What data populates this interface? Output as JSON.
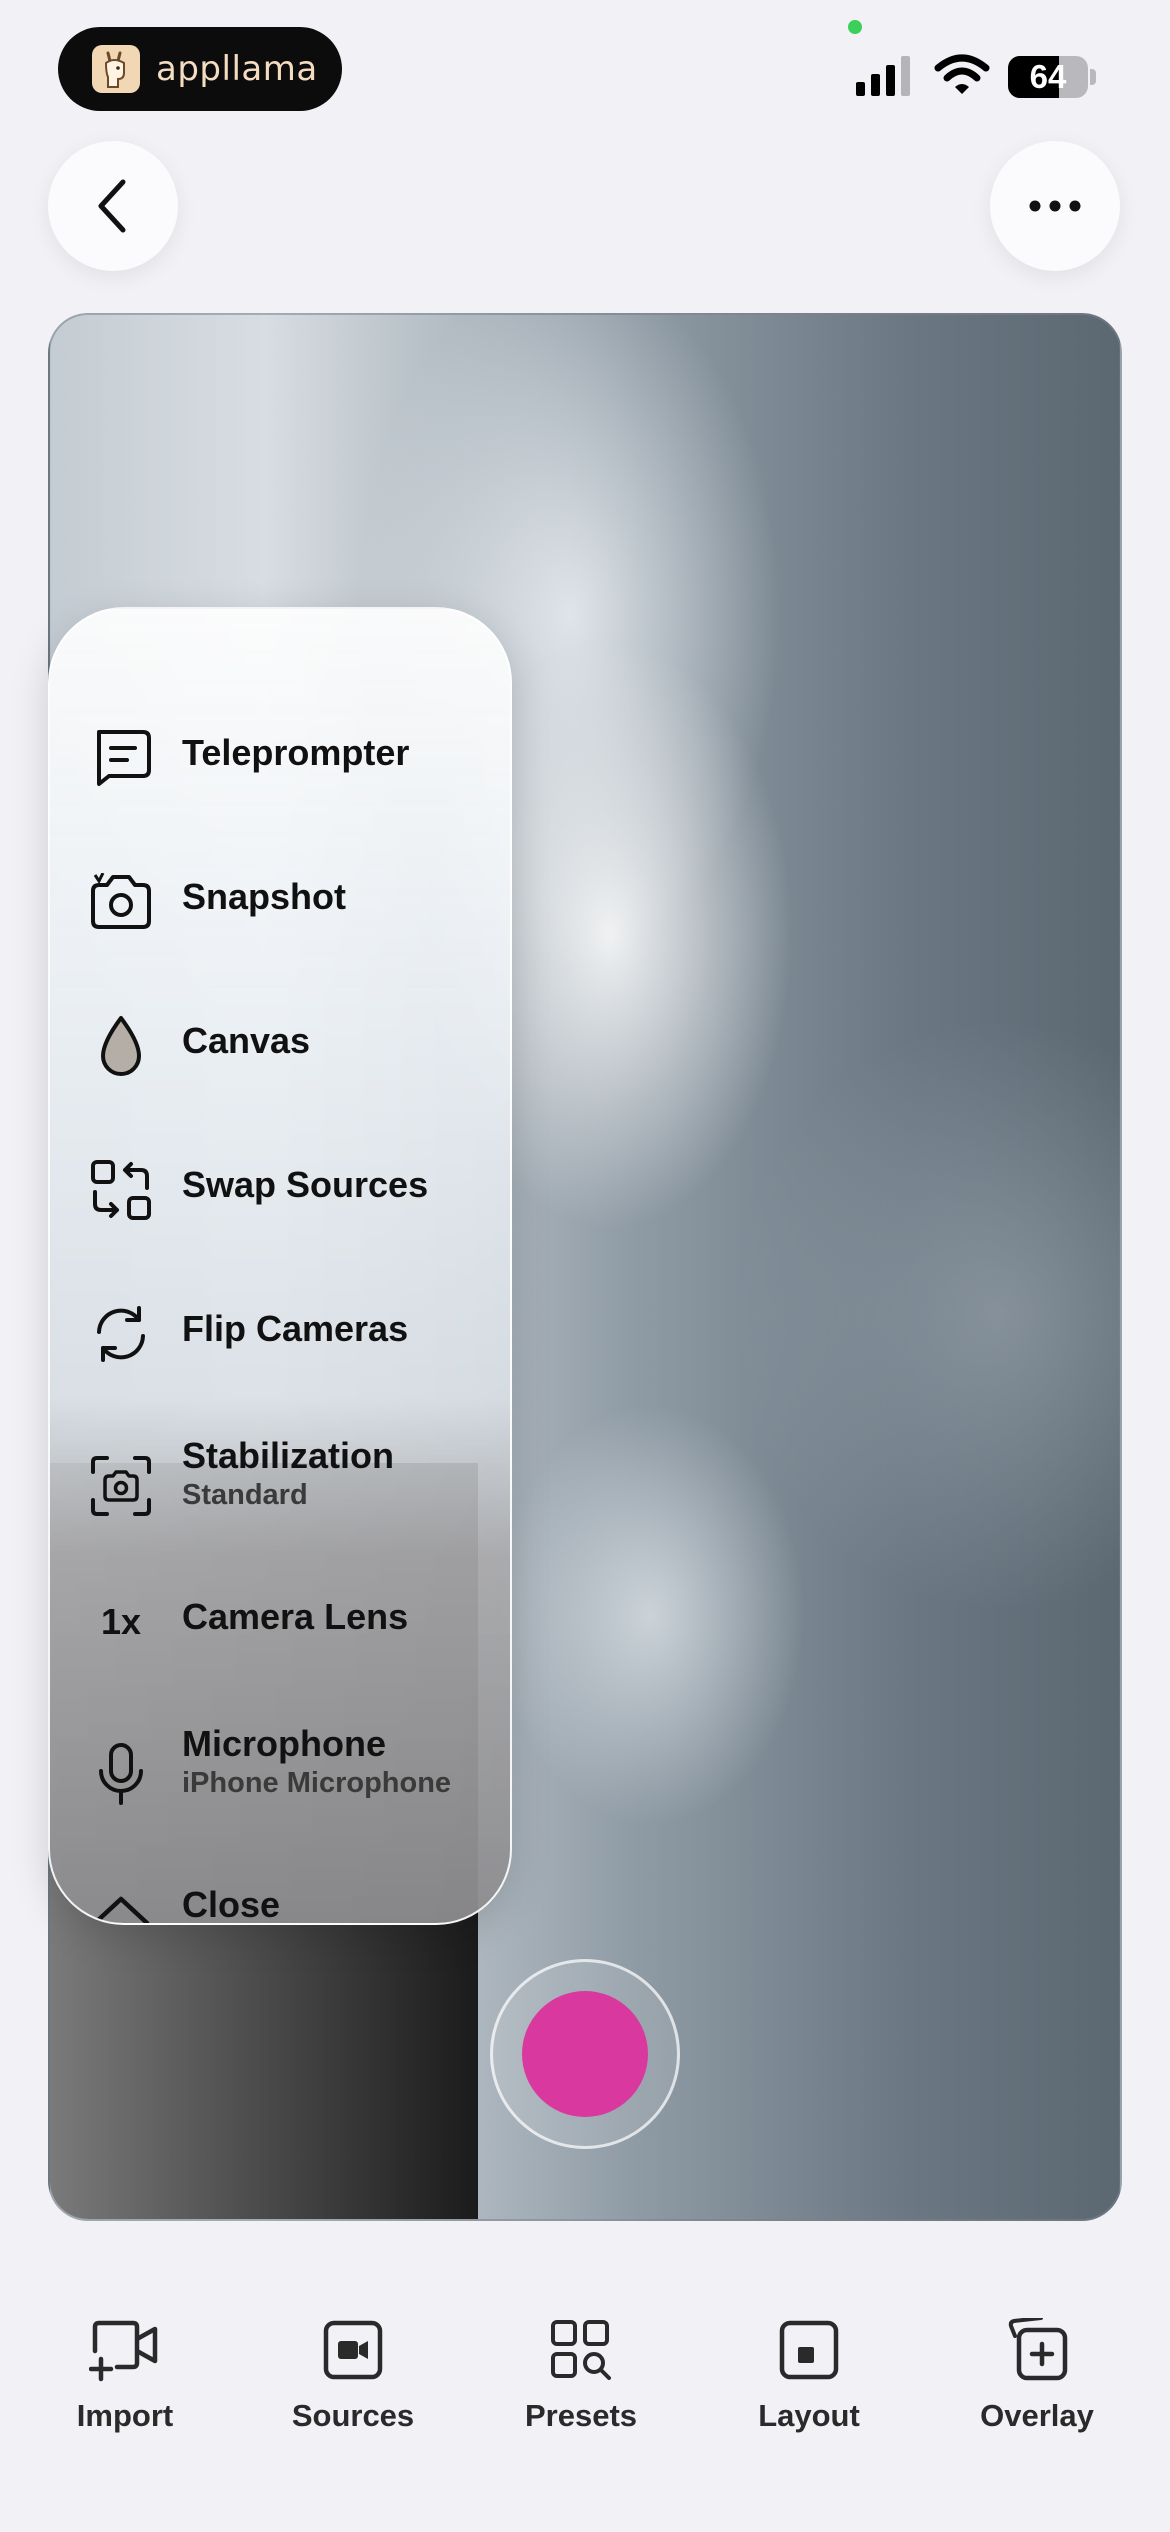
{
  "status_bar": {
    "brand_name": "appllama",
    "battery_level": "64",
    "battery_fraction": 0.64
  },
  "nav": {
    "back_icon": "chevron-left-icon",
    "more_icon": "ellipsis-icon"
  },
  "menu": {
    "items": [
      {
        "label": "Teleprompter",
        "sublabel": "",
        "icon": "teleprompter-icon"
      },
      {
        "label": "Snapshot",
        "sublabel": "",
        "icon": "camera-icon"
      },
      {
        "label": "Canvas",
        "sublabel": "",
        "icon": "drop-icon"
      },
      {
        "label": "Swap Sources",
        "sublabel": "",
        "icon": "swap-icon"
      },
      {
        "label": "Flip Cameras",
        "sublabel": "",
        "icon": "flip-icon"
      },
      {
        "label": "Stabilization",
        "sublabel": "Standard",
        "icon": "stabilization-icon"
      },
      {
        "label": "Camera Lens",
        "sublabel": "",
        "icon": "lens-icon",
        "icon_text": "1x"
      },
      {
        "label": "Microphone",
        "sublabel": "iPhone Microphone",
        "icon": "microphone-icon"
      },
      {
        "label": "Close",
        "sublabel": "",
        "icon": "chevron-up-icon"
      }
    ]
  },
  "record": {
    "color": "#d9399e"
  },
  "tabs": [
    {
      "label": "Import",
      "icon": "import-video-icon"
    },
    {
      "label": "Sources",
      "icon": "video-source-icon"
    },
    {
      "label": "Presets",
      "icon": "grid-search-icon"
    },
    {
      "label": "Layout",
      "icon": "layout-icon"
    },
    {
      "label": "Overlay",
      "icon": "overlay-add-icon"
    }
  ]
}
